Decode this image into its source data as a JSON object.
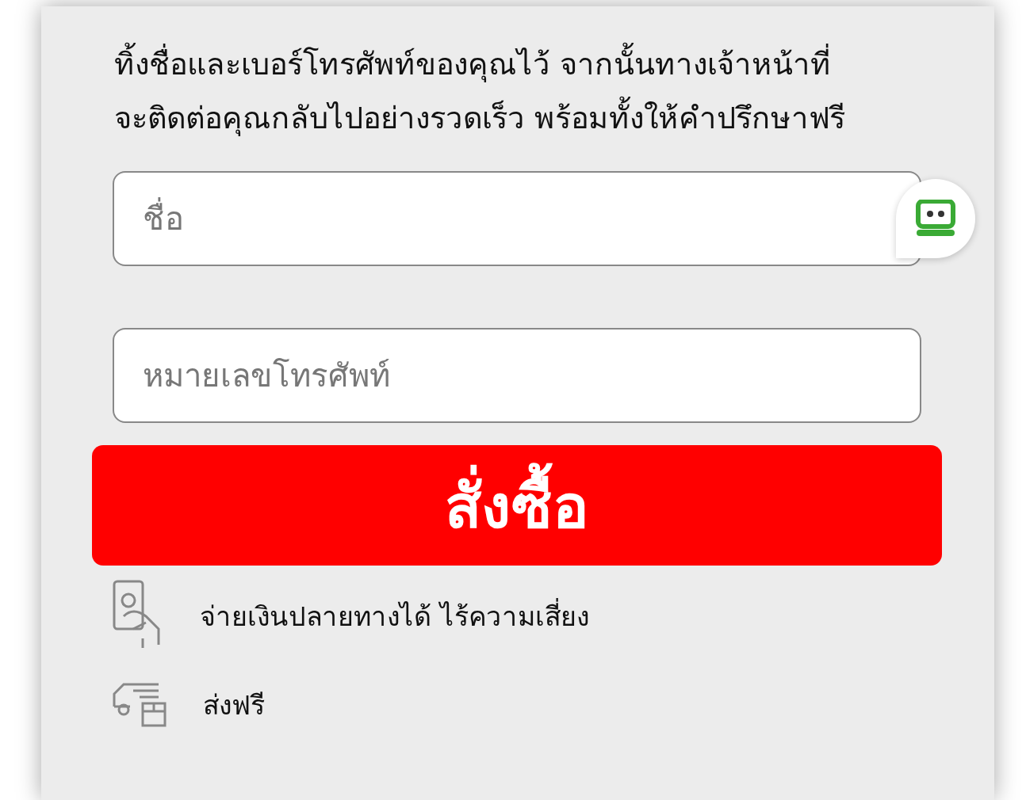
{
  "intro": "ทิ้งชื่อและเบอร์โทรศัพท์ของคุณไว้ จากนั้นทางเจ้าหน้าที่จะติดต่อคุณกลับไปอย่างรวดเร็ว พร้อมทั้งให้คำปรึกษาฟรี",
  "fields": [
    {
      "placeholder": "ชื่อ"
    },
    {
      "placeholder": "หมายเลขโทรศัพท์"
    }
  ],
  "order_button": "สั่งซื้อ",
  "features": [
    {
      "kind": "cash",
      "text": "จ่ายเงินปลายทางได้ ไร้ความเสี่ยง"
    },
    {
      "kind": "shipping",
      "text": "ส่งฟรี"
    }
  ]
}
